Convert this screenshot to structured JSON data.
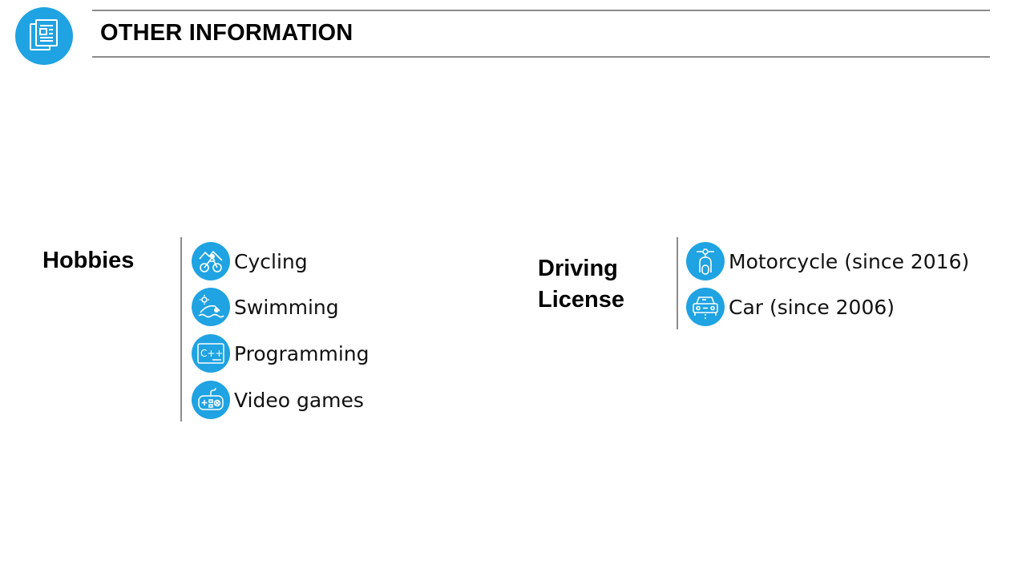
{
  "header": {
    "title": "OTHER INFORMATION",
    "icon": "document-stack-icon",
    "accent_color": "#1fa3e2"
  },
  "hobbies": {
    "label": "Hobbies",
    "items": [
      {
        "label": "Cycling",
        "icon": "cycling-icon"
      },
      {
        "label": "Swimming",
        "icon": "swimming-icon"
      },
      {
        "label": "Programming",
        "icon": "cpp-code-icon"
      },
      {
        "label": "Video games",
        "icon": "gamepad-icon"
      }
    ]
  },
  "driving": {
    "label_line1": "Driving",
    "label_line2": "License",
    "items": [
      {
        "label": "Motorcycle (since 2016)",
        "icon": "scooter-icon"
      },
      {
        "label": "Car (since 2006)",
        "icon": "car-icon"
      }
    ]
  }
}
